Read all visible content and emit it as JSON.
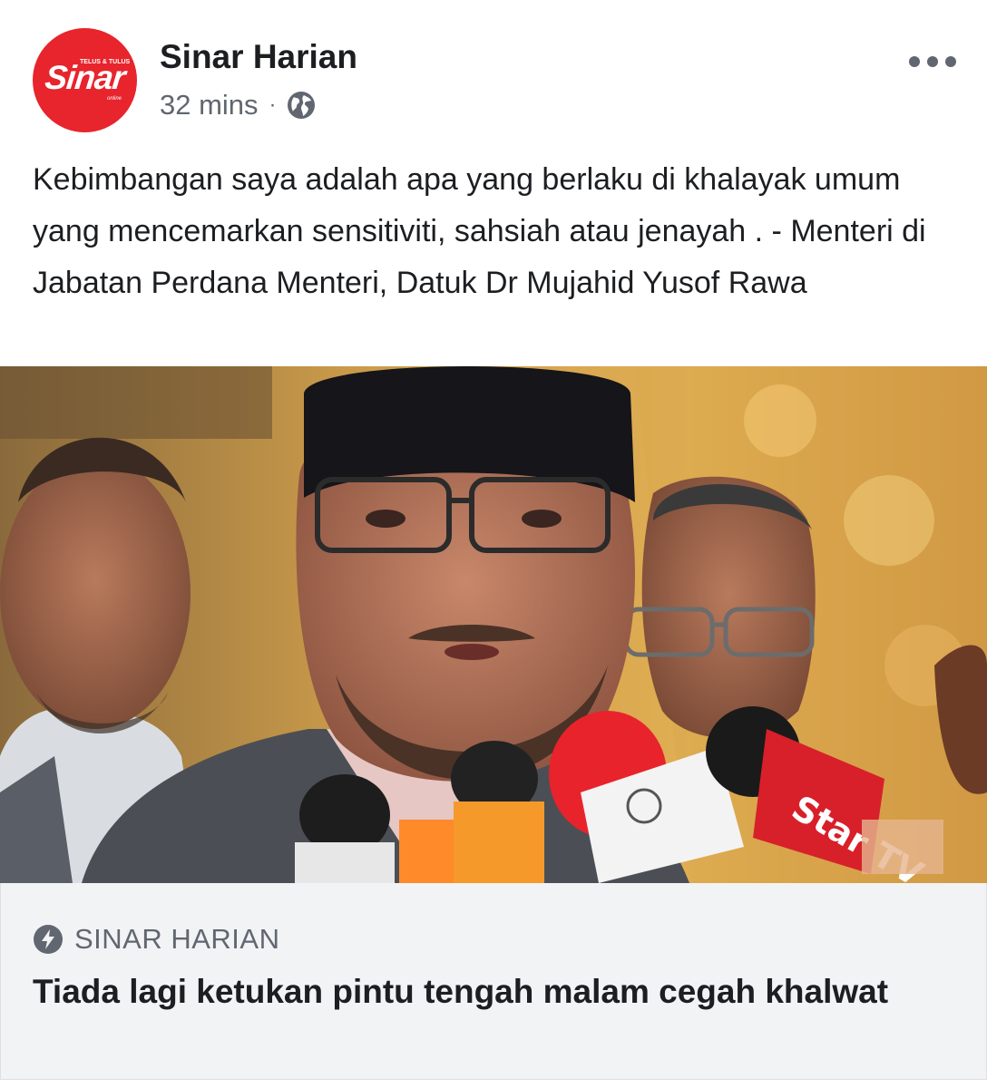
{
  "post": {
    "page_name": "Sinar Harian",
    "time": "32 mins",
    "separator": "·",
    "privacy_icon": "globe-icon",
    "more_icon": "more-options-icon",
    "avatar": {
      "brand_word": "Sinar",
      "tagline": "TELUS & TULUS",
      "sub": "online",
      "color": "#e8242c"
    },
    "message": "Kebimbangan saya adalah apa yang berlaku di khalayak umum yang mencemarkan sensitiviti, sahsiah atau jenayah . - Menteri di Jabatan Perdana Menteri, Datuk Dr Mujahid Yusof Rawa",
    "photo": {
      "mic_labels": [
        "Star TV"
      ]
    },
    "link": {
      "icon": "lightning-bolt-icon",
      "source": "SINAR HARIAN",
      "title": "Tiada lagi ketukan pintu tengah malam cegah khalwat"
    }
  }
}
